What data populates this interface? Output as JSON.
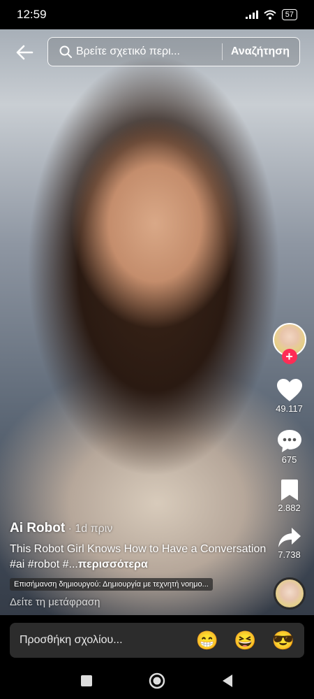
{
  "status": {
    "time": "12:59",
    "battery": "57"
  },
  "search": {
    "placeholder": "Βρείτε σχετικό περι...",
    "button": "Αναζήτηση"
  },
  "rail": {
    "likes": "49.117",
    "comments": "675",
    "saves": "2.882",
    "shares": "7.738"
  },
  "caption": {
    "author": "Ai Robot",
    "time": " · 1d πριν",
    "text": "This Robot Girl Knows How to Have a Conversation #ai #robot #...",
    "more": "περισσότερα",
    "badge": "Επισήμανση δημιουργού: Δημιουργία με τεχνητή νοημο...",
    "translate": "Δείτε τη μετάφραση"
  },
  "comment": {
    "placeholder": "Προσθήκη σχολίου...",
    "emojis": [
      "😁",
      "😆",
      "😎"
    ]
  },
  "colors": {
    "like": "#ffffff",
    "follow": "#fe2c55",
    "comment_bar": "#2c2c2c"
  }
}
